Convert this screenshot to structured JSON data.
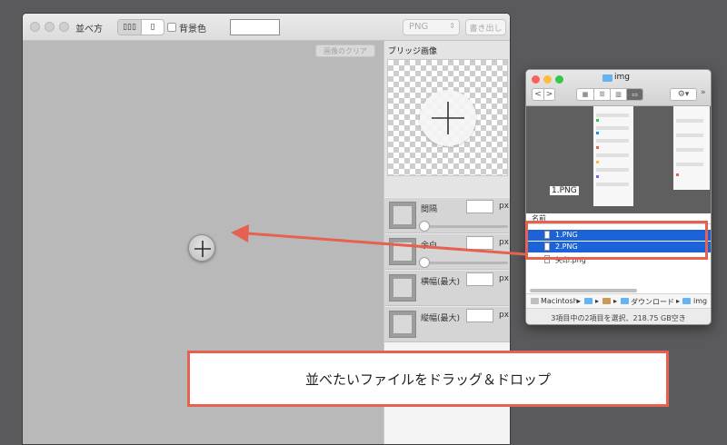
{
  "app": {
    "toolbar": {
      "arrange_label": "並べ方",
      "arrange_modes": [
        "▯▯▯",
        "▯"
      ],
      "bg_color_label": "背景色",
      "format_value": "PNG",
      "export_label": "書き出し"
    },
    "canvas": {
      "clear_label": "画像のクリア",
      "add_icon": "plus-icon"
    },
    "panel": {
      "bridge_title": "ブリッジ画像",
      "rows": [
        {
          "label": "間隔",
          "unit": "px",
          "value": ""
        },
        {
          "label": "余白",
          "unit": "px",
          "value": ""
        },
        {
          "label": "横幅(最大)",
          "unit": "px",
          "value": ""
        },
        {
          "label": "縦幅(最大)",
          "unit": "px",
          "value": ""
        }
      ]
    }
  },
  "finder": {
    "title": "img",
    "nav": {
      "back": "<",
      "forward": ">"
    },
    "view_modes": [
      "▦",
      "☰",
      "▥",
      "▭"
    ],
    "gear": "⚙▾",
    "more": "»",
    "thumb_label": "1.PNG",
    "list_header": "名前",
    "files": [
      {
        "name": "1.PNG",
        "selected": true
      },
      {
        "name": "2.PNG",
        "selected": true
      },
      {
        "name": "矢印.png",
        "selected": false
      }
    ],
    "path": [
      "Macintosh",
      "▸",
      "▸",
      "▸",
      "ダウンロード",
      "▸",
      "img"
    ],
    "status": "3項目中の2項目を選択、218.75 GB空き"
  },
  "caption": "並べたいファイルをドラッグ＆ドロップ",
  "colors": {
    "accent": "#e66150",
    "selection": "#1b63d6",
    "canvas": "#b9b9b9"
  }
}
